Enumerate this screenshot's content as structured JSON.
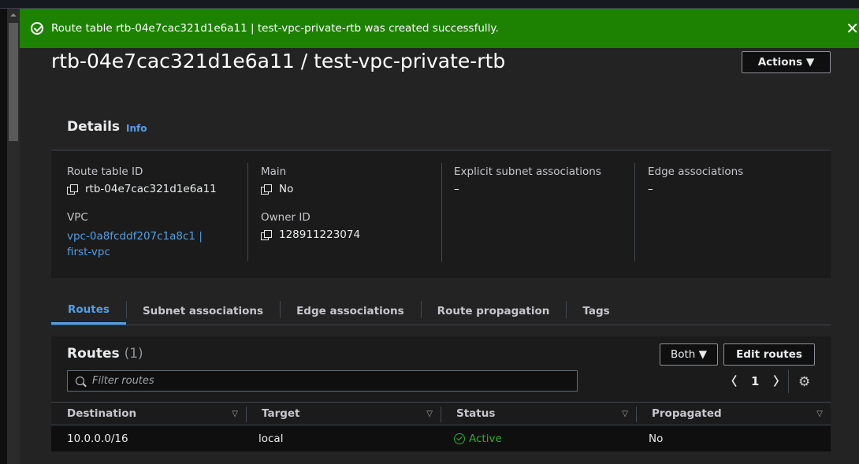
{
  "banner": {
    "message": "Route table rtb-04e7cac321d1e6a11 | test-vpc-private-rtb was created successfully.",
    "close": "✕",
    "color": "#1d8102"
  },
  "page": {
    "title": "rtb-04e7cac321d1e6a11 / test-vpc-private-rtb",
    "actions_label": "Actions ▼"
  },
  "details": {
    "title": "Details",
    "info": "Info",
    "route_table_id": {
      "label": "Route table ID",
      "value": "rtb-04e7cac321d1e6a11"
    },
    "vpc": {
      "label": "VPC",
      "value": "vpc-0a8fcddf207c1a8c1 | first-vpc"
    },
    "main": {
      "label": "Main",
      "value": "No"
    },
    "owner_id": {
      "label": "Owner ID",
      "value": "128911223074"
    },
    "explicit_subnet": {
      "label": "Explicit subnet associations",
      "value": "–"
    },
    "edge": {
      "label": "Edge associations",
      "value": "–"
    }
  },
  "tabs": [
    "Routes",
    "Subnet associations",
    "Edge associations",
    "Route propagation",
    "Tags"
  ],
  "routes": {
    "title": "Routes",
    "count": "(1)",
    "filter_value": "Both ▼",
    "edit_label": "Edit routes",
    "filter_placeholder": "Filter routes",
    "page": "1",
    "columns": [
      "Destination",
      "Target",
      "Status",
      "Propagated"
    ],
    "rows": [
      {
        "destination": "10.0.0.0/16",
        "target": "local",
        "status": "Active",
        "propagated": "No"
      }
    ]
  }
}
